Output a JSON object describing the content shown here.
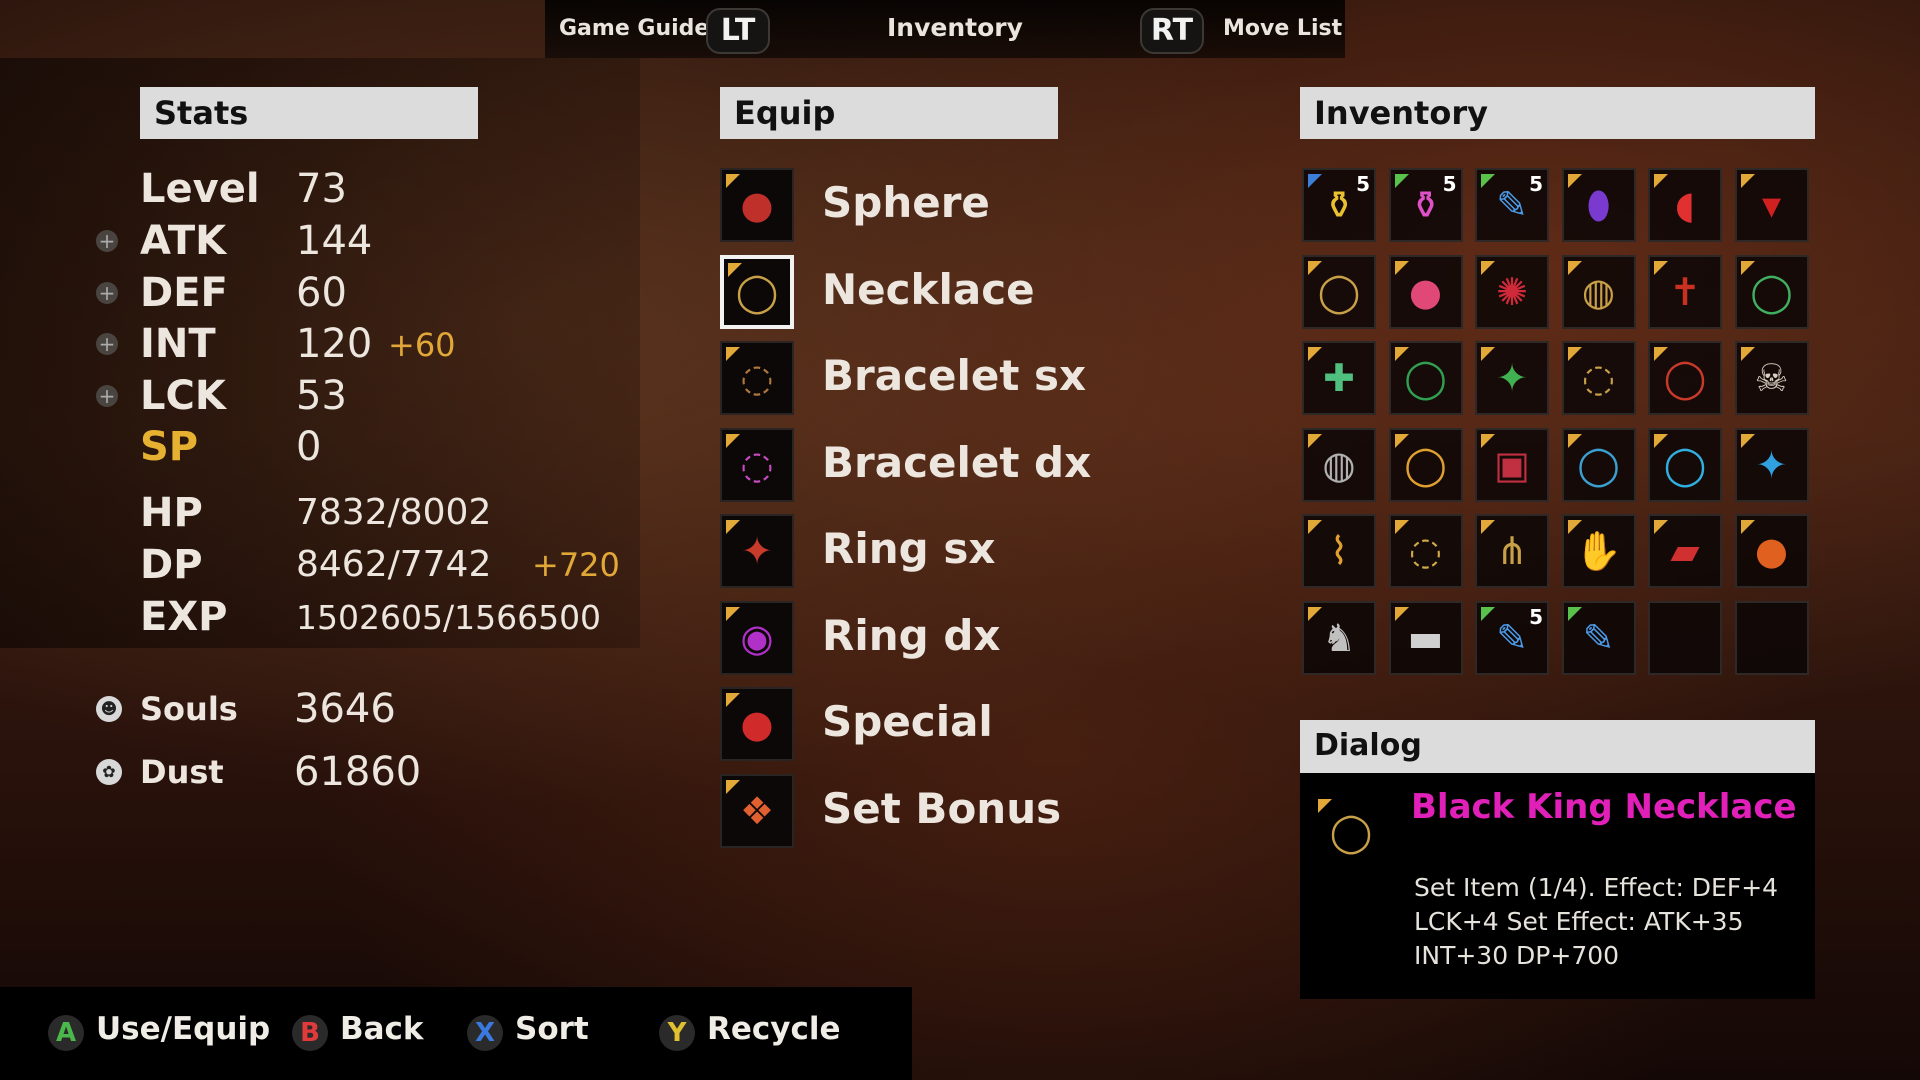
{
  "topbar": {
    "left_label": "Game Guide",
    "left_trigger": "LT",
    "center_label": "Inventory",
    "right_trigger": "RT",
    "right_label": "Move List"
  },
  "stats": {
    "title": "Stats",
    "level": {
      "label": "Level",
      "value": "73"
    },
    "atk": {
      "label": "ATK",
      "value": "144"
    },
    "def": {
      "label": "DEF",
      "value": "60"
    },
    "int": {
      "label": "INT",
      "value": "120",
      "bonus": "+60"
    },
    "lck": {
      "label": "LCK",
      "value": "53"
    },
    "sp": {
      "label": "SP",
      "value": "0"
    },
    "hp": {
      "label": "HP",
      "value": "7832/8002"
    },
    "dp": {
      "label": "DP",
      "value": "8462/7742",
      "bonus": "+720"
    },
    "exp": {
      "label": "EXP",
      "value": "1502605/1566500"
    },
    "plus_symbol": "+"
  },
  "resources": {
    "souls": {
      "label": "Souls",
      "value": "3646"
    },
    "dust": {
      "label": "Dust",
      "value": "61860"
    }
  },
  "equip": {
    "title": "Equip",
    "slots": [
      {
        "name": "Sphere",
        "icon": "sphere-icon",
        "glyph": "●",
        "color": "#c0302a"
      },
      {
        "name": "Necklace",
        "icon": "necklace-icon",
        "glyph": "◯",
        "color": "#c8a048"
      },
      {
        "name": "Bracelet sx",
        "icon": "bracelet-icon",
        "glyph": "◌",
        "color": "#b0783a"
      },
      {
        "name": "Bracelet dx",
        "icon": "bracelet-icon",
        "glyph": "◌",
        "color": "#c84ac0"
      },
      {
        "name": "Ring sx",
        "icon": "ring-icon",
        "glyph": "✦",
        "color": "#c83a2a"
      },
      {
        "name": "Ring dx",
        "icon": "ring-icon",
        "glyph": "◉",
        "color": "#b030c8"
      },
      {
        "name": "Special",
        "icon": "special-icon",
        "glyph": "●",
        "color": "#d02a2a"
      },
      {
        "name": "Set Bonus",
        "icon": "set-bonus-icon",
        "glyph": "❖",
        "color": "#e06030"
      }
    ]
  },
  "inventory": {
    "title": "Inventory",
    "items": [
      {
        "icon": "yellow-potion-icon",
        "glyph": "⚱",
        "color": "#e8c030",
        "qty": "5",
        "corner": "blue"
      },
      {
        "icon": "pink-potion-icon",
        "glyph": "⚱",
        "color": "#e050c8",
        "qty": "5",
        "corner": "green"
      },
      {
        "icon": "scroll-icon",
        "glyph": "✎",
        "color": "#4a9ae8",
        "qty": "5",
        "corner": "green"
      },
      {
        "icon": "purple-orb-icon",
        "glyph": "⬮",
        "color": "#7a3ad0",
        "qty": "",
        "corner": "gold"
      },
      {
        "icon": "pill-icon",
        "glyph": "◖",
        "color": "#e03030",
        "qty": "",
        "corner": "gold"
      },
      {
        "icon": "red-wing-icon",
        "glyph": "▾",
        "color": "#d02020",
        "qty": "",
        "corner": "gold"
      },
      {
        "icon": "necklace-icon",
        "glyph": "◯",
        "color": "#c8a048",
        "qty": "",
        "corner": "gold"
      },
      {
        "icon": "pink-gem-icon",
        "glyph": "●",
        "color": "#e04878",
        "qty": "",
        "corner": "gold"
      },
      {
        "icon": "red-gem-icon",
        "glyph": "✺",
        "color": "#d02a3a",
        "qty": "",
        "corner": "gold"
      },
      {
        "icon": "ring-icon",
        "glyph": "◍",
        "color": "#c8a048",
        "qty": "",
        "corner": "gold"
      },
      {
        "icon": "cross-icon",
        "glyph": "✝",
        "color": "#c83020",
        "qty": "",
        "corner": "gold"
      },
      {
        "icon": "green-necklace-icon",
        "glyph": "◯",
        "color": "#40b060",
        "qty": "",
        "corner": "gold"
      },
      {
        "icon": "cross-necklace-icon",
        "glyph": "✚",
        "color": "#50c080",
        "qty": "",
        "corner": "gold"
      },
      {
        "icon": "emerald-necklace-icon",
        "glyph": "◯",
        "color": "#30a050",
        "qty": "",
        "corner": "gold"
      },
      {
        "icon": "green-ring-icon",
        "glyph": "✦",
        "color": "#40b050",
        "qty": "",
        "corner": "gold"
      },
      {
        "icon": "bead-bracelet-icon",
        "glyph": "◌",
        "color": "#c8a048",
        "qty": "",
        "corner": "gold"
      },
      {
        "icon": "red-pendant-icon",
        "glyph": "◯",
        "color": "#c83a2a",
        "qty": "",
        "corner": "gold"
      },
      {
        "icon": "skull-bracelet-icon",
        "glyph": "☠",
        "color": "#d8d0c0",
        "qty": "",
        "corner": "gold"
      },
      {
        "icon": "silver-ring-icon",
        "glyph": "◍",
        "color": "#b0b0b0",
        "qty": "",
        "corner": "gold"
      },
      {
        "icon": "gold-ring-icon",
        "glyph": "◯",
        "color": "#e0a030",
        "qty": "",
        "corner": "gold"
      },
      {
        "icon": "card-icon",
        "glyph": "▣",
        "color": "#c03040",
        "qty": "",
        "corner": "gold"
      },
      {
        "icon": "blue-necklace-icon",
        "glyph": "◯",
        "color": "#3aa0d0",
        "qty": "",
        "corner": "gold"
      },
      {
        "icon": "blue-pendant-icon",
        "glyph": "◯",
        "color": "#30b0e0",
        "qty": "",
        "corner": "gold"
      },
      {
        "icon": "blue-bracelet-icon",
        "glyph": "✦",
        "color": "#30a0e0",
        "qty": "",
        "corner": "gold"
      },
      {
        "icon": "horn-icon",
        "glyph": "⌇",
        "color": "#e0a030",
        "qty": "",
        "corner": "gold"
      },
      {
        "icon": "chain-bracelet-icon",
        "glyph": "◌",
        "color": "#d0a848",
        "qty": "",
        "corner": "gold"
      },
      {
        "icon": "tassel-necklace-icon",
        "glyph": "⋔",
        "color": "#c8a048",
        "qty": "",
        "corner": "gold"
      },
      {
        "icon": "gauntlet-icon",
        "glyph": "✋",
        "color": "#c89040",
        "qty": "",
        "corner": "gold"
      },
      {
        "icon": "red-shoe-icon",
        "glyph": "▰",
        "color": "#d03030",
        "qty": "",
        "corner": "gold"
      },
      {
        "icon": "orange-orb-icon",
        "glyph": "●",
        "color": "#e06020",
        "qty": "",
        "corner": "gold"
      },
      {
        "icon": "horse-icon",
        "glyph": "♞",
        "color": "#c0c0c0",
        "qty": "",
        "corner": "gold"
      },
      {
        "icon": "glasses-icon",
        "glyph": "▬",
        "color": "#d0d0d0",
        "qty": "",
        "corner": "gold"
      },
      {
        "icon": "scroll-icon",
        "glyph": "✎",
        "color": "#4a9ae8",
        "qty": "5",
        "corner": "green"
      },
      {
        "icon": "scroll-icon",
        "glyph": "✎",
        "color": "#4a9ae8",
        "qty": "",
        "corner": "green"
      },
      {
        "icon": "empty-slot",
        "glyph": "",
        "color": "#000",
        "qty": "",
        "corner": "none"
      },
      {
        "icon": "empty-slot",
        "glyph": "",
        "color": "#000",
        "qty": "",
        "corner": "none"
      }
    ]
  },
  "dialog": {
    "title": "Dialog",
    "item_name": "Black King Necklace",
    "item_name_color": "#e020b8",
    "desc_line1": "Set Item (1/4). Effect: DEF+4",
    "desc_line2": "LCK+4 Set Effect: ATK+35",
    "desc_line3": "INT+30 DP+700"
  },
  "bottom": {
    "a": {
      "key": "A",
      "label": "Use/Equip",
      "color": "#4ab84a"
    },
    "b": {
      "key": "B",
      "label": "Back",
      "color": "#e03a3a"
    },
    "x": {
      "key": "X",
      "label": "Sort",
      "color": "#3a7ae0"
    },
    "y": {
      "key": "Y",
      "label": "Recycle",
      "color": "#e0c030"
    }
  }
}
